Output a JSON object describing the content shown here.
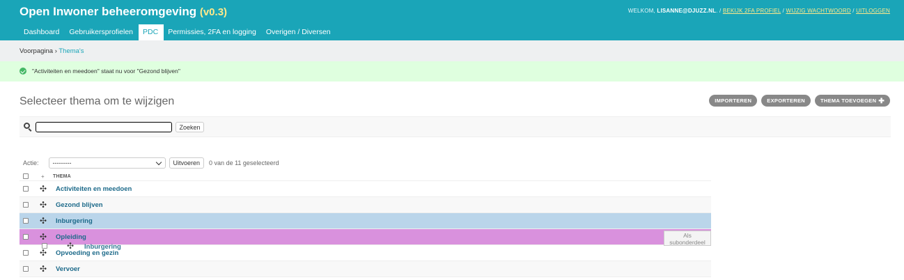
{
  "header": {
    "title": "Open Inwoner beheeromgeving",
    "version": "(v0.3)",
    "welcome": "WELKOM,",
    "user": "LISANNE@DJUZZ.NL",
    "links": [
      "BEKIJK 2FA PROFIEL",
      "WIJZIG WACHTWOORD",
      "UITLOGGEN"
    ]
  },
  "nav": {
    "items": [
      "Dashboard",
      "Gebruikersprofielen",
      "PDC",
      "Permissies, 2FA en logging",
      "Overigen / Diversen"
    ],
    "active_index": 2
  },
  "breadcrumbs": {
    "home": "Voorpagina",
    "current": "Thema's"
  },
  "message": "\"Activiteiten en meedoen\" staat nu voor \"Gezond blijven\"",
  "page_title": "Selecteer thema om te wijzigen",
  "object_tools": {
    "import": "IMPORTEREN",
    "export": "EXPORTEREN",
    "add": "THEMA TOEVOEGEN"
  },
  "search": {
    "value": "",
    "button": "Zoeken"
  },
  "actions": {
    "label": "Actie:",
    "selected": "---------",
    "run": "Uitvoeren",
    "counter": "0 van de 11 geselecteerd"
  },
  "table": {
    "header_plus": "+",
    "column": "THEMA",
    "rows": [
      "Activiteiten en meedoen",
      "Gezond blijven",
      "Inburgering",
      "Opleiding",
      "Opvoeding en gezin",
      "Vervoer"
    ],
    "selected_index": 2,
    "drop_index": 3
  },
  "drag_ghost": "Inburgering",
  "drop_hint": {
    "line1": "Als",
    "line2": "subonderdeel"
  },
  "colors": {
    "header": "#1aa5b8",
    "accent_text": "#ffe98a",
    "success_bg": "#dfffdf",
    "selected_row": "#bad5ea",
    "drop_row": "#d991dd",
    "link": "#1d6a8a"
  },
  "icons": {
    "search": "search-icon",
    "success": "check-circle-icon",
    "drag": "drag-handle-icon",
    "plus": "plus-icon",
    "select": "chevron-down-icon"
  }
}
